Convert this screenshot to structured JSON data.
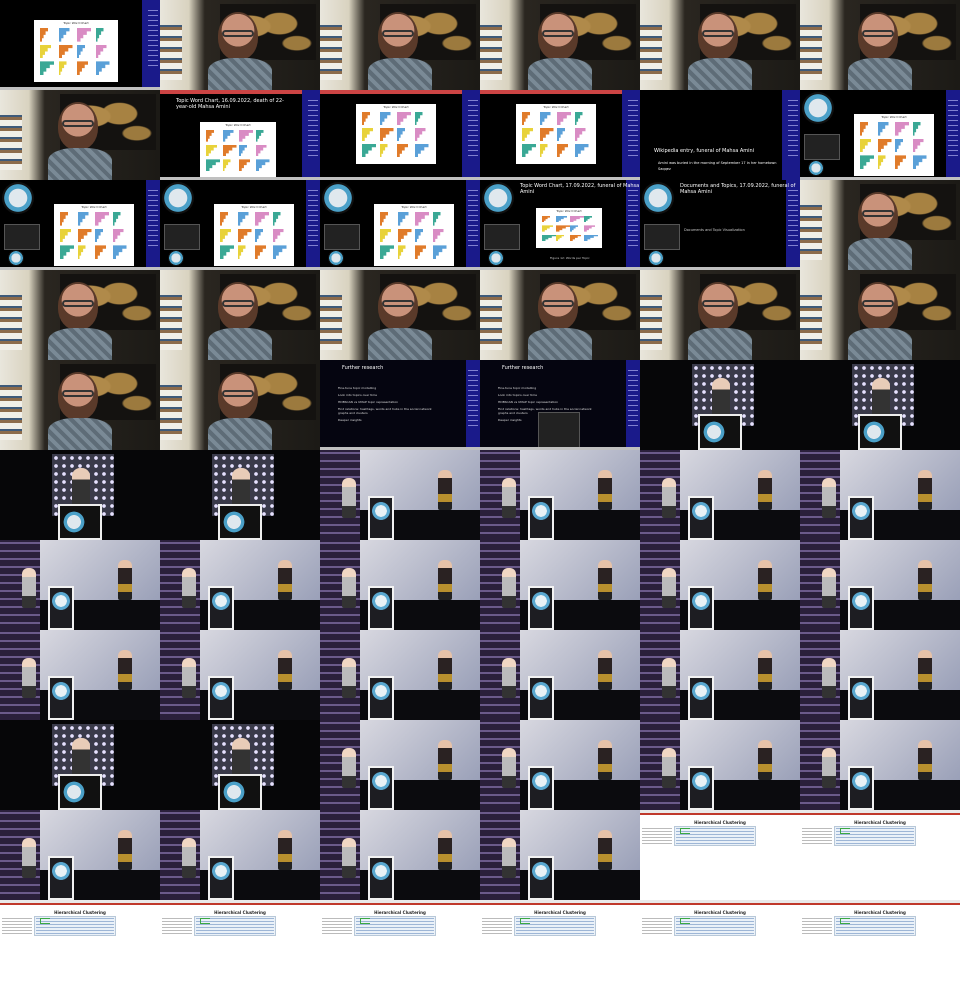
{
  "slides": {
    "topic_word_chart_title": "Topic Word Chart",
    "topic_word_chart_full": "Topic Word Chart, 16.09.2022, death of 22-year-old Mahsa Amini",
    "topic_word_chart_funeral": "Topic Word Chart, 17.09.2022, funeral of Mahsa Amini",
    "wikipedia_title": "Wikipedia entry, funeral of Mahsa Amini",
    "wikipedia_bullet": "Amini was buried in the morning of September 17 in her hometown Saqqez",
    "documents_topics_title": "Documents and Topics, 17.09.2022, funeral of Mahsa Amini",
    "documents_topics_body": "Documents and Topic Visualization",
    "further_research_title": "Further research",
    "further_research_bullets": [
      "Fine-tune topic modelling",
      "Look into topics over time",
      "HDBSCAN vs UMAP topic representation",
      "Find relations: hashtags, words and hubs in the social network graphs and clusters",
      "Deeper insights"
    ],
    "figure_caption": "Figure 12: Words per Topic"
  },
  "dendrogram": {
    "title": "Hierarchical Clustering"
  },
  "colors": {
    "sidebar": "#1a1a8a",
    "menubar_red": "#c0392b",
    "bar_orange": "#e07b2a",
    "bar_blue": "#5aa0d8",
    "bar_pink": "#d98cc4",
    "bar_green": "#3aa895",
    "bar_yellow": "#e8d23a"
  }
}
